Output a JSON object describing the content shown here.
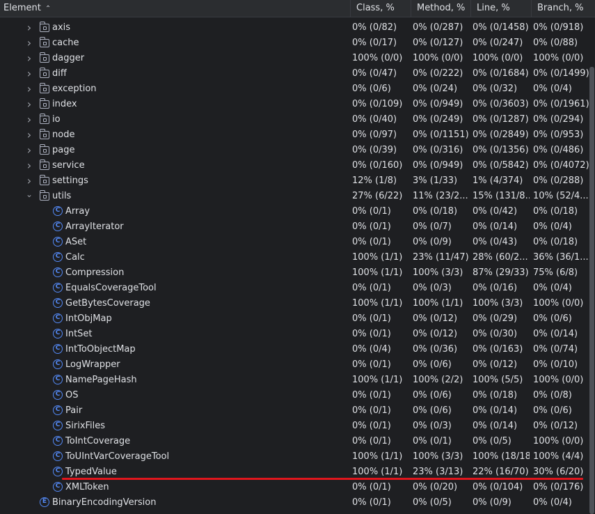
{
  "columns": {
    "element": "Element",
    "class": "Class, %",
    "method": "Method, %",
    "line": "Line, %",
    "branch": "Branch, %"
  },
  "icons": {
    "sort": "sort-ascending-icon",
    "folder": "package-icon",
    "class": "class-icon",
    "enum": "enum-icon"
  },
  "colors": {
    "background": "#1e1f22",
    "header": "#2b2d30",
    "class_icon": "#548af7",
    "highlight_underline": "#e0161d"
  },
  "rows": [
    {
      "type": "package",
      "expanded": false,
      "name": "axis",
      "class": "0% (0/82)",
      "method": "0% (0/287)",
      "line": "0% (0/1458)",
      "branch": "0% (0/918)"
    },
    {
      "type": "package",
      "expanded": false,
      "name": "cache",
      "class": "0% (0/17)",
      "method": "0% (0/127)",
      "line": "0% (0/247)",
      "branch": "0% (0/88)"
    },
    {
      "type": "package",
      "expanded": false,
      "name": "dagger",
      "class": "100% (0/0)",
      "method": "100% (0/0)",
      "line": "100% (0/0)",
      "branch": "100% (0/0)"
    },
    {
      "type": "package",
      "expanded": false,
      "name": "diff",
      "class": "0% (0/47)",
      "method": "0% (0/222)",
      "line": "0% (0/1684)",
      "branch": "0% (0/1499)"
    },
    {
      "type": "package",
      "expanded": false,
      "name": "exception",
      "class": "0% (0/6)",
      "method": "0% (0/24)",
      "line": "0% (0/32)",
      "branch": "0% (0/4)"
    },
    {
      "type": "package",
      "expanded": false,
      "name": "index",
      "class": "0% (0/109)",
      "method": "0% (0/949)",
      "line": "0% (0/3603)",
      "branch": "0% (0/1961)"
    },
    {
      "type": "package",
      "expanded": false,
      "name": "io",
      "class": "0% (0/40)",
      "method": "0% (0/249)",
      "line": "0% (0/1287)",
      "branch": "0% (0/294)"
    },
    {
      "type": "package",
      "expanded": false,
      "name": "node",
      "class": "0% (0/97)",
      "method": "0% (0/1151)",
      "line": "0% (0/2849)",
      "branch": "0% (0/953)"
    },
    {
      "type": "package",
      "expanded": false,
      "name": "page",
      "class": "0% (0/39)",
      "method": "0% (0/316)",
      "line": "0% (0/1356)",
      "branch": "0% (0/486)"
    },
    {
      "type": "package",
      "expanded": false,
      "name": "service",
      "class": "0% (0/160)",
      "method": "0% (0/949)",
      "line": "0% (0/5842)",
      "branch": "0% (0/4072)"
    },
    {
      "type": "package",
      "expanded": false,
      "name": "settings",
      "class": "12% (1/8)",
      "method": "3% (1/33)",
      "line": "1% (4/374)",
      "branch": "0% (0/288)"
    },
    {
      "type": "package",
      "expanded": true,
      "name": "utils",
      "class": "27% (6/22)",
      "method": "11% (23/2...",
      "line": "15% (131/8...",
      "branch": "10% (52/4..."
    },
    {
      "type": "class",
      "name": "Array",
      "class": "0% (0/1)",
      "method": "0% (0/18)",
      "line": "0% (0/42)",
      "branch": "0% (0/18)"
    },
    {
      "type": "class",
      "name": "ArrayIterator",
      "class": "0% (0/1)",
      "method": "0% (0/7)",
      "line": "0% (0/14)",
      "branch": "0% (0/4)"
    },
    {
      "type": "class",
      "name": "ASet",
      "class": "0% (0/1)",
      "method": "0% (0/9)",
      "line": "0% (0/43)",
      "branch": "0% (0/18)"
    },
    {
      "type": "class",
      "name": "Calc",
      "class": "100% (1/1)",
      "method": "23% (11/47)",
      "line": "28% (60/2...",
      "branch": "36% (36/1..."
    },
    {
      "type": "class",
      "name": "Compression",
      "class": "100% (1/1)",
      "method": "100% (3/3)",
      "line": "87% (29/33)",
      "branch": "75% (6/8)"
    },
    {
      "type": "class",
      "name": "EqualsCoverageTool",
      "class": "0% (0/1)",
      "method": "0% (0/3)",
      "line": "0% (0/16)",
      "branch": "0% (0/4)"
    },
    {
      "type": "class",
      "name": "GetBytesCoverage",
      "class": "100% (1/1)",
      "method": "100% (1/1)",
      "line": "100% (3/3)",
      "branch": "100% (0/0)"
    },
    {
      "type": "class",
      "name": "IntObjMap",
      "class": "0% (0/1)",
      "method": "0% (0/12)",
      "line": "0% (0/29)",
      "branch": "0% (0/6)"
    },
    {
      "type": "class",
      "name": "IntSet",
      "class": "0% (0/1)",
      "method": "0% (0/12)",
      "line": "0% (0/30)",
      "branch": "0% (0/14)"
    },
    {
      "type": "class",
      "name": "IntToObjectMap",
      "class": "0% (0/4)",
      "method": "0% (0/36)",
      "line": "0% (0/163)",
      "branch": "0% (0/74)"
    },
    {
      "type": "class",
      "name": "LogWrapper",
      "class": "0% (0/1)",
      "method": "0% (0/6)",
      "line": "0% (0/12)",
      "branch": "0% (0/10)"
    },
    {
      "type": "class",
      "name": "NamePageHash",
      "class": "100% (1/1)",
      "method": "100% (2/2)",
      "line": "100% (5/5)",
      "branch": "100% (0/0)"
    },
    {
      "type": "class",
      "name": "OS",
      "class": "0% (0/1)",
      "method": "0% (0/6)",
      "line": "0% (0/18)",
      "branch": "0% (0/8)"
    },
    {
      "type": "class",
      "name": "Pair",
      "class": "0% (0/1)",
      "method": "0% (0/6)",
      "line": "0% (0/14)",
      "branch": "0% (0/6)"
    },
    {
      "type": "class",
      "name": "SirixFiles",
      "class": "0% (0/1)",
      "method": "0% (0/3)",
      "line": "0% (0/14)",
      "branch": "0% (0/12)"
    },
    {
      "type": "class",
      "name": "ToIntCoverage",
      "class": "0% (0/1)",
      "method": "0% (0/1)",
      "line": "0% (0/5)",
      "branch": "100% (0/0)"
    },
    {
      "type": "class",
      "name": "ToUIntVarCoverageTool",
      "class": "100% (1/1)",
      "method": "100% (3/3)",
      "line": "100% (18/18)",
      "branch": "100% (4/4)"
    },
    {
      "type": "class",
      "name": "TypedValue",
      "class": "100% (1/1)",
      "method": "23% (3/13)",
      "line": "22% (16/70)",
      "branch": "30% (6/20)",
      "highlighted": true
    },
    {
      "type": "class",
      "name": "XMLToken",
      "class": "0% (0/1)",
      "method": "0% (0/20)",
      "line": "0% (0/104)",
      "branch": "0% (0/176)"
    },
    {
      "type": "enum",
      "name": "BinaryEncodingVersion",
      "class": "0% (0/1)",
      "method": "0% (0/5)",
      "line": "0% (0/9)",
      "branch": "0% (0/4)"
    }
  ]
}
